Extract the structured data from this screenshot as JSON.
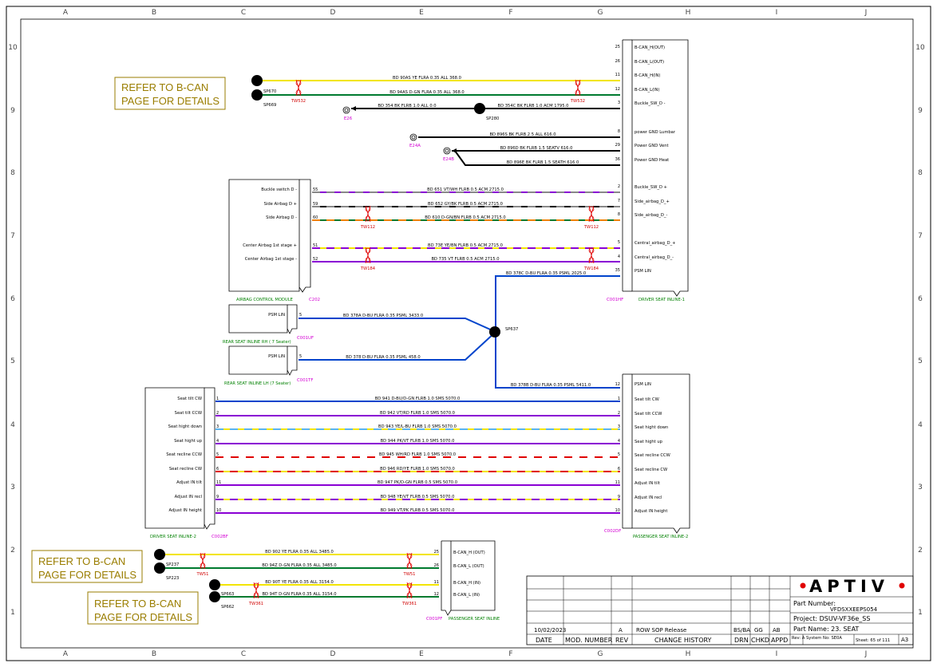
{
  "colors": {
    "yellow": "#f2e500",
    "green": "#007a2f",
    "black": "#000000",
    "purple": "#8a00d4",
    "blue": "#0044cc",
    "red": "#e00000",
    "orange": "#f08000",
    "grey": "#888888",
    "lightblue": "#5ab4f0",
    "magenta": "#d400d4",
    "gold": "#9a7d00",
    "aptiv_red": "#e00000"
  },
  "grid": {
    "columns": [
      "A",
      "B",
      "C",
      "D",
      "E",
      "F",
      "G",
      "H",
      "I",
      "J"
    ],
    "rows": [
      "10",
      "9",
      "8",
      "7",
      "6",
      "5",
      "4",
      "3",
      "2",
      "1"
    ]
  },
  "refer_notes": [
    {
      "line1": "REFER TO  B-CAN",
      "line2": "PAGE FOR DETAILS"
    },
    {
      "line1": "REFER TO  B-CAN",
      "line2": "PAGE FOR DETAILS"
    },
    {
      "line1": "REFER TO  B-CAN",
      "line2": "PAGE FOR DETAILS"
    }
  ],
  "splices": [
    "SP670",
    "SP669",
    "SP280",
    "SP637",
    "SP237",
    "SP223",
    "SP663",
    "SP662"
  ],
  "grounds": [
    "E26",
    "E24A",
    "E24B"
  ],
  "twists": [
    "TW532",
    "TW532",
    "TW112",
    "TW112",
    "TW184",
    "TW184",
    "TW51",
    "TW51",
    "TW361",
    "TW361"
  ],
  "connectors": {
    "c001hf": "C001HF",
    "driver_inline1": "DRIVER SEAT INLINE-1",
    "c202": "C202",
    "airbag_module": "AIRBAG CONTROL MODULE",
    "c001uf": "C001UF",
    "rear_rh": "REAR SEAT INLINE RH  ( 7 Seater)",
    "c001tf": "C001TF",
    "rear_lh": "REAR SEAT INLINE LH (7 Seater)",
    "c002bf": "C002BF",
    "driver_inline2": "DRIVER SEAT INLINE-2",
    "c002df": "C002DF",
    "passenger_inline2": "PASSENGER SEAT INLINE-2",
    "c001pf": "C001PF",
    "passenger_inline": "PASSENGER SEAT INLINE"
  },
  "top_block": {
    "pins": [
      {
        "num": "25",
        "label": "B-CAN_H(OUT)"
      },
      {
        "num": "26",
        "label": "B-CAN_L(OUT)"
      },
      {
        "num": "11",
        "label": "B-CAN_H(IN)"
      },
      {
        "num": "12",
        "label": "B-CAN_L(IN)"
      },
      {
        "num": "3",
        "label": "Buckle_SW_D -"
      },
      {
        "num": "8",
        "label": "power GND Lumbar"
      },
      {
        "num": "29",
        "label": "Power GND Vent"
      },
      {
        "num": "36",
        "label": "Power GND Heat"
      },
      {
        "num": "2",
        "label": "Buckle_SW_D +"
      },
      {
        "num": "7",
        "label": "Side_airbag_D_+"
      },
      {
        "num": "8",
        "label": "Side_airbag_D_-"
      },
      {
        "num": "5",
        "label": "Central_airbag_D_+"
      },
      {
        "num": "4",
        "label": "Central_airbag_D_-"
      },
      {
        "num": "35",
        "label": "PSM LIN"
      }
    ]
  },
  "airbag_pins": [
    {
      "num": "55",
      "label": "Buckle switch D -"
    },
    {
      "num": "59",
      "label": "Side Airbag D +"
    },
    {
      "num": "60",
      "label": "Side Airbag D -"
    },
    {
      "num": "51",
      "label": "Center Airbag 1st stage +"
    },
    {
      "num": "52",
      "label": "Center Airbag 1st stage -"
    }
  ],
  "wires_top": [
    "BD  90AS  YE  FLRA  0.35  ALL  368.0",
    "BD  94AS  D-GN  FLRA  0.35  ALL  368.0",
    "BD  354  BK  FLRB  1.0  ALL  0.0",
    "BD  354C  BK  FLRB  1.0  ACM  1795.0",
    "BD  896S  BK  FLRB  2.5  ALL  616.0",
    "BD  896D  BK  FLRB  1.5  SEATV  616.0",
    "BD  896E  BK  FLRB  1.5  SEATH  616.0",
    "BD  651  VT/WH  FLRB  0.5  ACM  2715.0",
    "BD  652  GY/BK  FLRB  0.5  ACM  2715.0",
    "BD  610  D-GN/BN  FLRB  0.5  ACM  2715.0",
    "BD  73E  YE/BN  FLRB  0.5  ACM  2715.0",
    "BD  735  VT  FLRB  0.5  ACM  2715.0",
    "BD  378C  D-BU  FLRA  0.35  PSML  2025.0",
    "BD  378A  D-BU  FLRA  0.35  PSML  3433.0",
    "BD  378  D-BU  FLRA  0.35  PSML  458.0",
    "BD  378B  D-BU  FLRA  0.35  PSML  5411.0"
  ],
  "psm_lin": "PSM LIN",
  "seat_pins": [
    {
      "num": "1",
      "label": "Seat tilt CW",
      "wire": "BD  941  D-BU/D-GN  FLRB  1.0  SMS  5070.0"
    },
    {
      "num": "2",
      "label": "Seat tilt CCW",
      "wire": "BD  942  VT/RD  FLRB  1.0  SMS  5070.0"
    },
    {
      "num": "3",
      "label": "Seat hight down",
      "wire": "BD  943  YE/L-BU  FLRB  1.0  SMS  5070.0"
    },
    {
      "num": "4",
      "label": "Seat hight up",
      "wire": "BD  944  PK/VT  FLRB  1.0  SMS  5070.0"
    },
    {
      "num": "5",
      "label": "Seat recline CCW",
      "wire": "BD  945  WH/RD  FLRB  1.0  SMS  5070.0"
    },
    {
      "num": "6",
      "label": "Seat recline CW",
      "wire": "BD  946  RD/YE  FLRB  1.0  SMS  5070.0"
    },
    {
      "num": "11",
      "label": "Adjust IN tilt",
      "wire": "BD  947  PK/D-GN  FLRB  0.5  SMS  5070.0"
    },
    {
      "num": "9",
      "label": "Adjust IN recl",
      "wire": "BD  948  YE/VT  FLRB  0.5  SMS  5070.0"
    },
    {
      "num": "10",
      "label": "Adjust IN height",
      "wire": "BD  949  VT/PK  FLRB  0.5  SMS  5070.0"
    }
  ],
  "bottom_wires": [
    {
      "num": "25",
      "label": "B-CAN_H (OUT)",
      "wire": "BD  902  YE  FLRA  0.35  ALL  3485.0"
    },
    {
      "num": "26",
      "label": "B-CAN_L (OUT)",
      "wire": "BD  94Z  D-GN  FLRA  0.35  ALL  3485.0"
    },
    {
      "num": "11",
      "label": "B-CAN_H (IN)",
      "wire": "BD  90T  YE  FLRA  0.35  ALL  3154.0"
    },
    {
      "num": "12",
      "label": "B-CAN_L (IN)",
      "wire": "BD  94T  D-GN  FLRA  0.35  ALL  3154.0"
    }
  ],
  "title_block": {
    "logo": "APTIV",
    "part_number_label": "Part Number:",
    "part_number": "VFDSXXEEPS054",
    "project": "Project: DSUV-VF36e_SS",
    "part_name": "Part Name: 23. SEAT",
    "date": "10/02/2023",
    "rev_letter": "A",
    "change": "ROW SOP Release",
    "drn": "BS/BA",
    "chkd": "GG",
    "appd": "AB",
    "headers": [
      "DATE",
      "MOD. NUMBER",
      "REV",
      "CHANGE HISTORY",
      "DRN",
      "CHKD",
      "APPD"
    ],
    "rev_small": "Rev: A",
    "system_no": "System No: SE0A",
    "sheet": "Sheet: 65  of 111",
    "size": "A3"
  }
}
